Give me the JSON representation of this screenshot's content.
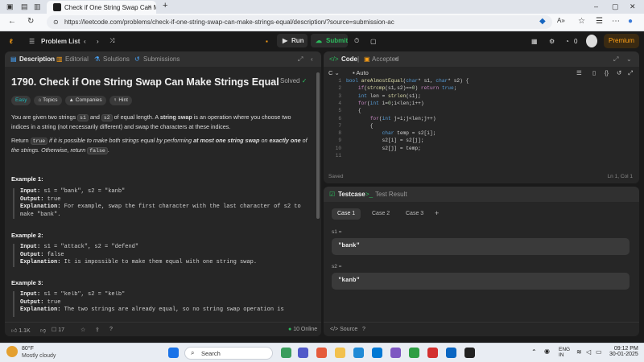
{
  "browser": {
    "tab_title": "Check if One String Swap Can Ma",
    "tab_close": "×",
    "new_tab": "+",
    "url": "https://leetcode.com/problems/check-if-one-string-swap-can-make-strings-equal/description/?source=submission-ac",
    "window_controls": [
      "–",
      "▢",
      "✕"
    ]
  },
  "header": {
    "problem_list": "Problem List",
    "run": "Run",
    "submit": "Submit",
    "streak": "0",
    "premium": "Premium"
  },
  "description_panel": {
    "tabs": [
      "Description",
      "Editorial",
      "Solutions",
      "Submissions"
    ],
    "title": "1790. Check if One String Swap Can Make Strings Equal",
    "solved": "Solved",
    "chips": [
      "Easy",
      "Topics",
      "Companies",
      "Hint"
    ],
    "para1_a": "You are given two strings ",
    "para1_s1": "s1",
    "para1_b": " and ",
    "para1_s2": "s2",
    "para1_c": " of equal length. A ",
    "para1_bold": "string swap",
    "para1_d": " is an operation where you choose two indices in a string (not necessarily different) and swap the characters at these indices.",
    "para2_a": "Return ",
    "para2_true": "true",
    "para2_b": " if it is possible to make both strings equal by performing ",
    "para2_bold1": "at most one string swap",
    "para2_c": " on ",
    "para2_bold2": "exactly one",
    "para2_d": " of the strings. Otherwise, return ",
    "para2_false": "false",
    "para2_e": ".",
    "examples": [
      {
        "heading": "Example 1:",
        "input": "s1 = \"bank\", s2 = \"kanb\"",
        "output": "true",
        "explanation": "For example, swap the first character with the last character of s2 to make \"bank\"."
      },
      {
        "heading": "Example 2:",
        "input": "s1 = \"attack\", s2 = \"defend\"",
        "output": "false",
        "explanation": "It is impossible to make them equal with one string swap."
      },
      {
        "heading": "Example 3:",
        "input": "s1 = \"kelb\", s2 = \"kelb\"",
        "output": "true",
        "explanation": "The two strings are already equal, so no string swap operation is"
      }
    ],
    "labels": {
      "input": "Input:",
      "output": "Output:",
      "explanation": "Explanation:"
    },
    "footer": {
      "likes": "1.1K",
      "comments": "17",
      "online": "10 Online"
    }
  },
  "code_panel": {
    "tabs": [
      "Code",
      "Accepted"
    ],
    "language": "C",
    "mode": "Auto",
    "status_left": "Saved",
    "status_right": "Ln 1, Col 1",
    "line_numbers": [
      "1",
      "2",
      "3",
      "4",
      "5",
      "6",
      "7",
      "8",
      "9",
      "10",
      "11"
    ],
    "lines": [
      "bool areAlmostEqual(char* s1, char* s2) {",
      "    if(strcmp(s1,s2)==0) return true;",
      "    int len = strlen(s1);",
      "    for(int i=0;i<len;i++)",
      "    {",
      "        for(int j=i;j<len;j++)",
      "        {",
      "            char temp = s2[i];",
      "            s2[i] = s2[j];",
      "            s2[j] = temp;",
      ""
    ]
  },
  "testcase_panel": {
    "tabs": [
      "Testcase",
      "Test Result"
    ],
    "cases": [
      "Case 1",
      "Case 2",
      "Case 3"
    ],
    "add": "+",
    "vars": [
      {
        "label": "s1 =",
        "value": "\"bank\""
      },
      {
        "label": "s2 =",
        "value": "\"kanb\""
      }
    ],
    "source": "Source"
  },
  "taskbar": {
    "weather_temp": "80°F",
    "weather_desc": "Mostly cloudy",
    "search": "Search",
    "lang1": "ENG",
    "lang2": "IN",
    "time": "09:12 PM",
    "date": "30-01-2025"
  }
}
